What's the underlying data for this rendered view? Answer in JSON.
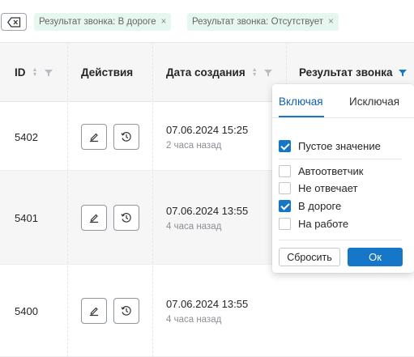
{
  "filters": {
    "tags": [
      {
        "label": "Результат звонка: В дороге"
      },
      {
        "label": "Результат звонка: Отсутствует"
      }
    ],
    "close_glyph": "×"
  },
  "table": {
    "columns": {
      "id": "ID",
      "actions": "Действия",
      "created": "Дата создания",
      "call_result": "Результат звонка"
    },
    "rows": [
      {
        "id": "5402",
        "date": "07.06.2024 15:25",
        "relative": "2 часа назад"
      },
      {
        "id": "5401",
        "date": "07.06.2024 13:55",
        "relative": "4 часа назад"
      },
      {
        "id": "5400",
        "date": "07.06.2024 13:55",
        "relative": "4 часа назад"
      }
    ]
  },
  "filter_dropdown": {
    "tabs": [
      "Включая",
      "Исключая"
    ],
    "active_tab": "Включая",
    "options": [
      {
        "label": "Пустое значение",
        "checked": true
      },
      {
        "label": "Автоответчик",
        "checked": false
      },
      {
        "label": "Не отвечает",
        "checked": false
      },
      {
        "label": "В дороге",
        "checked": true
      },
      {
        "label": "На работе",
        "checked": false
      }
    ],
    "reset_label": "Сбросить",
    "ok_label": "Ок"
  },
  "colors": {
    "accent": "#1677c8",
    "tag_bg": "#e6f7f0",
    "header_bg": "#f6f6f7"
  },
  "icons": {
    "clear": "backspace-icon",
    "edit": "edit-icon",
    "history": "history-icon",
    "sort": "sort-icon",
    "filter": "filter-icon"
  }
}
